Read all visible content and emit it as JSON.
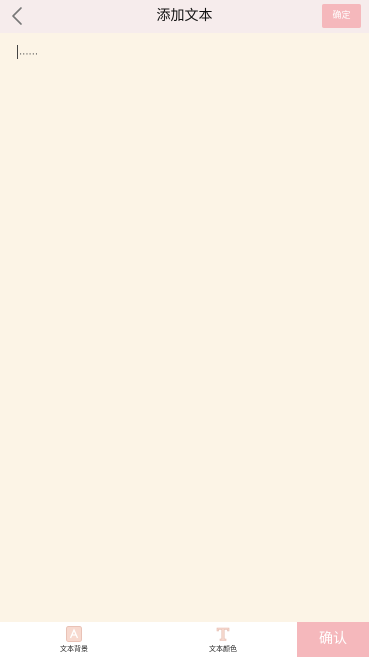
{
  "header": {
    "title": "添加文本",
    "confirm_label": "确定",
    "back_icon": "chevron-left-icon"
  },
  "editor": {
    "placeholder": "......",
    "background_color": "#fcf4e6"
  },
  "toolbar": {
    "items": [
      {
        "label": "文本背景",
        "icon": "text-background-icon"
      },
      {
        "label": "文本颜色",
        "icon": "text-color-icon"
      }
    ],
    "confirm_label": "确认"
  },
  "colors": {
    "header_bg": "#f6ecec",
    "accent_pink": "#f5b8bc"
  }
}
